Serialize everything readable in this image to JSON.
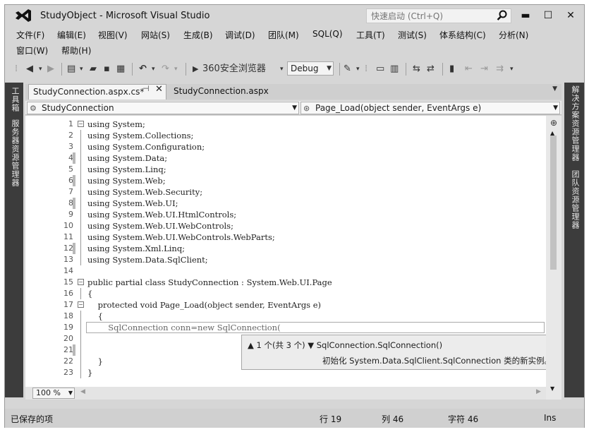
{
  "window": {
    "title": "StudyObject - Microsoft Visual Studio",
    "quick_launch_placeholder": "快速启动 (Ctrl+Q)",
    "minimize": "▬",
    "maximize": "☐",
    "close": "✕"
  },
  "menu": {
    "row1": [
      "文件(F)",
      "编辑(E)",
      "视图(V)",
      "网站(S)",
      "生成(B)",
      "调试(D)",
      "团队(M)",
      "SQL(Q)",
      "工具(T)",
      "测试(S)",
      "体系结构(C)",
      "分析(N)"
    ],
    "row2": [
      "窗口(W)",
      "帮助(H)"
    ]
  },
  "toolbar": {
    "browser": "360安全浏览器",
    "config": "Debug"
  },
  "left_strip": {
    "toolbox": "工具箱",
    "server_explorer": "服务器资源管理器"
  },
  "right_strip": {
    "solution_explorer": "解决方案资源管理器",
    "team_explorer": "团队资源管理器"
  },
  "tabs": {
    "active": "StudyConnection.aspx.cs*",
    "second": "StudyConnection.aspx"
  },
  "navbar": {
    "class_combo": "StudyConnection",
    "method_combo": "Page_Load(object sender, EventArgs e)"
  },
  "code_lines": [
    {
      "n": "1",
      "t": "using System;"
    },
    {
      "n": "2",
      "t": "using System.Collections;"
    },
    {
      "n": "3",
      "t": "using System.Configuration;"
    },
    {
      "n": "4",
      "t": "using System.Data;"
    },
    {
      "n": "5",
      "t": "using System.Linq;"
    },
    {
      "n": "6",
      "t": "using System.Web;"
    },
    {
      "n": "7",
      "t": "using System.Web.Security;"
    },
    {
      "n": "8",
      "t": "using System.Web.UI;"
    },
    {
      "n": "9",
      "t": "using System.Web.UI.HtmlControls;"
    },
    {
      "n": "10",
      "t": "using System.Web.UI.WebControls;"
    },
    {
      "n": "11",
      "t": "using System.Web.UI.WebControls.WebParts;"
    },
    {
      "n": "12",
      "t": "using System.Xml.Linq;"
    },
    {
      "n": "13",
      "t": "using System.Data.SqlClient;"
    },
    {
      "n": "14",
      "t": ""
    },
    {
      "n": "15",
      "t": "public partial class StudyConnection : System.Web.UI.Page"
    },
    {
      "n": "16",
      "t": "{"
    },
    {
      "n": "17",
      "t": "    protected void Page_Load(object sender, EventArgs e)"
    },
    {
      "n": "18",
      "t": "    {"
    },
    {
      "n": "19",
      "t": "        SqlConnection conn=new SqlConnection("
    },
    {
      "n": "20",
      "t": ""
    },
    {
      "n": "21",
      "t": ""
    },
    {
      "n": "22",
      "t": "    }"
    },
    {
      "n": "23",
      "t": "}"
    }
  ],
  "tooltip": {
    "overload": "▲ 1 个(共 3 个) ▼ SqlConnection.SqlConnection()",
    "description": "初始化 System.Data.SqlClient.SqlConnection 类的新实例。"
  },
  "zoom": "100 %",
  "status": {
    "left": "已保存的项",
    "line": "行 19",
    "col": "列 46",
    "char": "字符 46",
    "mode": "Ins"
  }
}
